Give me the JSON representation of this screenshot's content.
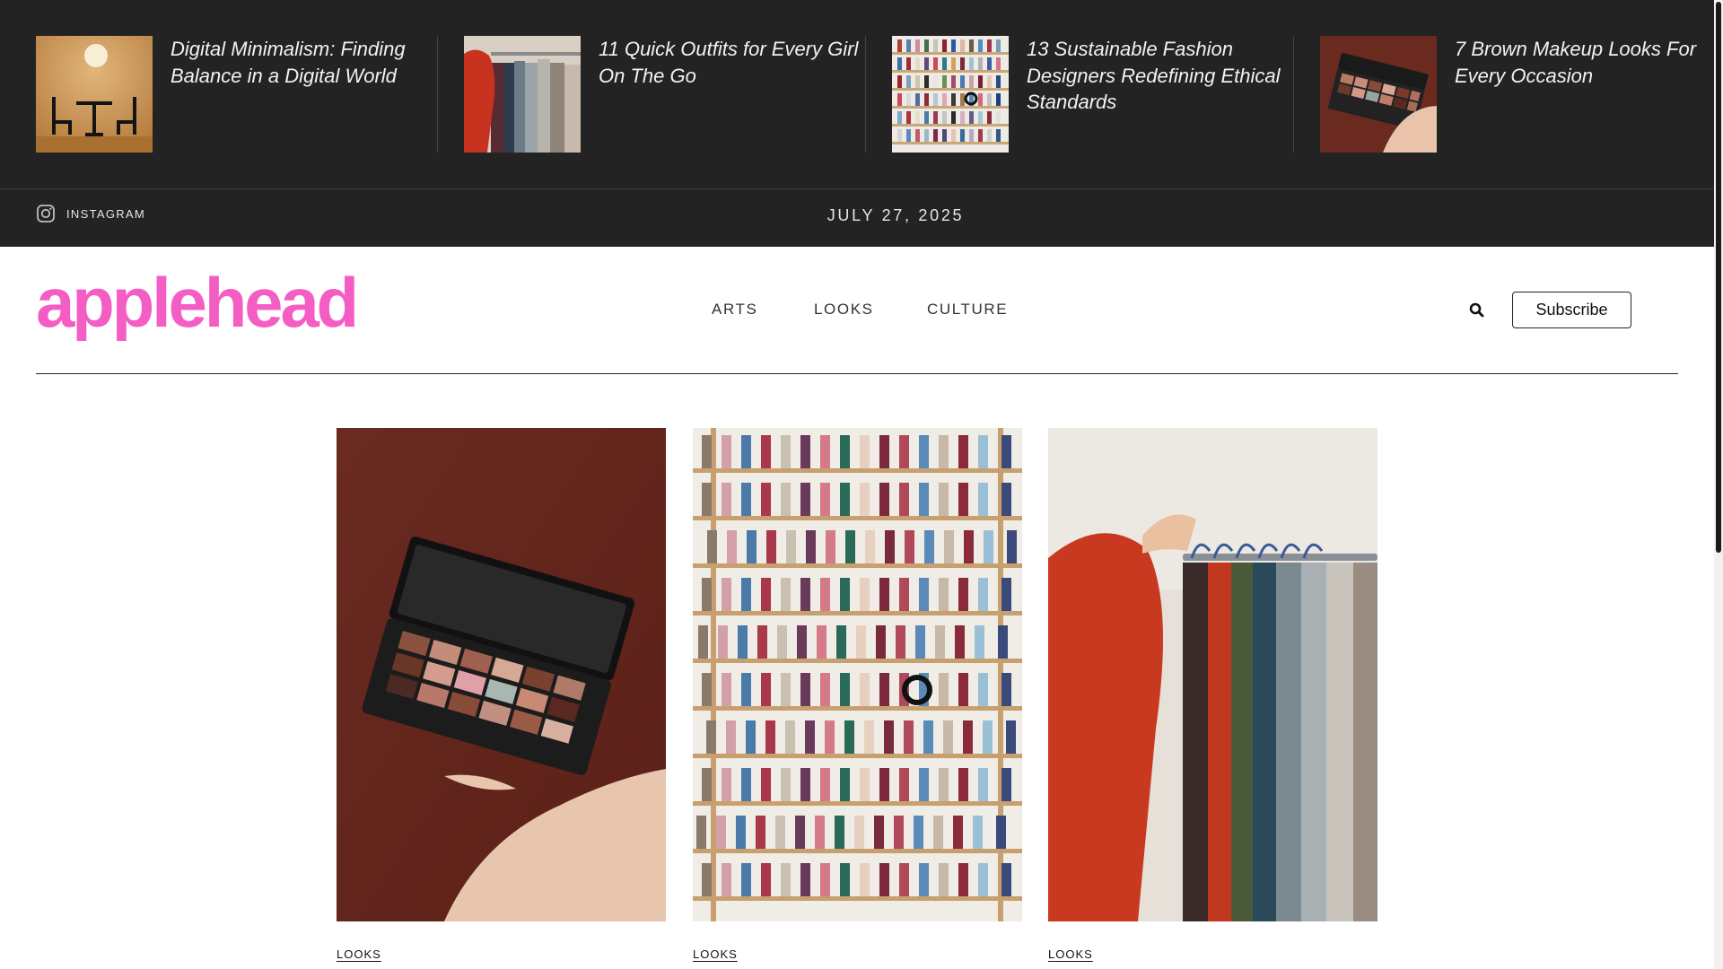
{
  "featured": [
    {
      "title": "Digital Minimalism: Finding Balance in a Digital World",
      "image": "chairs-table-warm-light"
    },
    {
      "title": "11 Quick Outfits for Every Girl On The Go",
      "image": "clothing-rack"
    },
    {
      "title": "13 Sustainable Fashion Designers Redefining Ethical Standards",
      "image": "thread-spools-shelf"
    },
    {
      "title": "7 Brown Makeup Looks For Every Occasion",
      "image": "eyeshadow-palette"
    }
  ],
  "social": {
    "label": "INSTAGRAM",
    "icon": "instagram-icon"
  },
  "date": "JULY 27, 2025",
  "logo": "applehead",
  "nav": [
    "ARTS",
    "LOOKS",
    "CULTURE"
  ],
  "search_icon": "search-icon",
  "subscribe_label": "Subscribe",
  "cards": [
    {
      "category": "LOOKS",
      "image": "eyeshadow-palette"
    },
    {
      "category": "LOOKS",
      "image": "thread-spools-shelf"
    },
    {
      "category": "LOOKS",
      "image": "clothing-rack"
    }
  ],
  "colors": {
    "topbar_bg": "#232323",
    "logo_pink": "#f45ec4",
    "text_light": "#f2f2f2"
  }
}
